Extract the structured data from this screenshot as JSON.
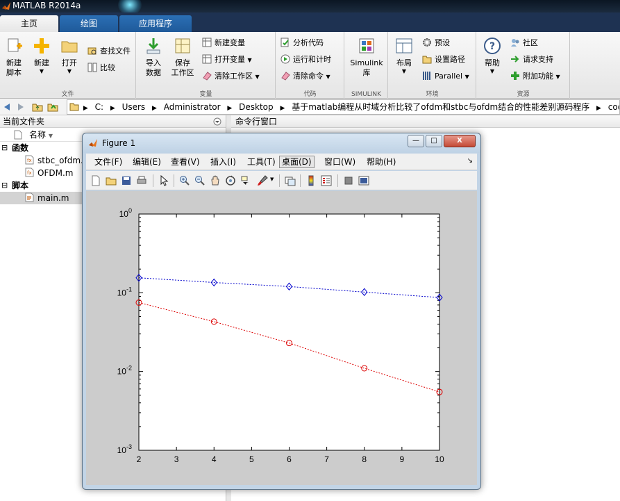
{
  "app": {
    "title": "MATLAB R2014a"
  },
  "tabs": [
    {
      "label": "主页",
      "active": true
    },
    {
      "label": "绘图",
      "active": false
    },
    {
      "label": "应用程序",
      "active": false
    }
  ],
  "ribbon": {
    "file": {
      "group_label": "文件",
      "new_script": "新建\n脚本",
      "new": "新建",
      "open": "打开",
      "find_files": "查找文件",
      "compare": "比较"
    },
    "variable": {
      "group_label": "变量",
      "import_data": "导入\n数据",
      "save_workspace": "保存\n工作区",
      "new_variable": "新建变量",
      "open_variable": "打开变量",
      "clear_workspace": "清除工作区"
    },
    "code": {
      "group_label": "代码",
      "analyze_code": "分析代码",
      "run_and_time": "运行和计时",
      "clear_commands": "清除命令"
    },
    "simulink": {
      "group_label": "SIMULINK",
      "library": "Simulink\n库"
    },
    "environment": {
      "group_label": "环境",
      "layout": "布局",
      "preferences": "预设",
      "set_path": "设置路径",
      "parallel": "Parallel"
    },
    "resources": {
      "group_label": "资源",
      "help": "帮助",
      "community": "社区",
      "request_support": "请求支持",
      "addons": "附加功能"
    }
  },
  "address": {
    "crumbs": [
      "C:",
      "Users",
      "Administrator",
      "Desktop",
      "基于matlab编程从时域分析比较了ofdm和stbc与ofdm结合的性能差别源码程序",
      "code"
    ]
  },
  "current_folder": {
    "header": "当前文件夹",
    "column_name": "名称",
    "groups": [
      {
        "label": "函数",
        "files": [
          "stbc_ofdm.m",
          "OFDM.m"
        ]
      },
      {
        "label": "脚本",
        "files": [
          "main.m"
        ]
      }
    ],
    "selected_file": "main.m"
  },
  "command_window": {
    "header": "命令行窗口"
  },
  "figure": {
    "title": "Figure 1",
    "menu": [
      "文件(F)",
      "编辑(E)",
      "查看(V)",
      "插入(I)",
      "工具(T)",
      "桌面(D)",
      "窗口(W)",
      "帮助(H)"
    ],
    "pressed_menu": "桌面(D)",
    "window_buttons": {
      "minimize": "—",
      "maximize": "□",
      "close": "X"
    }
  },
  "chart_data": {
    "type": "line",
    "x": [
      2,
      4,
      6,
      8,
      10
    ],
    "xlim": [
      2,
      10
    ],
    "xticks": [
      2,
      3,
      4,
      5,
      6,
      7,
      8,
      9,
      10
    ],
    "ylim": [
      0.001,
      1
    ],
    "yscale": "log",
    "yticks": [
      0.001,
      0.01,
      0.1,
      1
    ],
    "ytick_labels": [
      {
        "base": "10",
        "exp": "-3"
      },
      {
        "base": "10",
        "exp": "-2"
      },
      {
        "base": "10",
        "exp": "-1"
      },
      {
        "base": "10",
        "exp": "0"
      }
    ],
    "grid": false,
    "series": [
      {
        "values": [
          0.155,
          0.135,
          0.12,
          0.102,
          0.087
        ],
        "color": "#0000cc",
        "marker": "diamond",
        "linestyle": "dotted"
      },
      {
        "values": [
          0.075,
          0.043,
          0.023,
          0.011,
          0.0055
        ],
        "color": "#dd0000",
        "marker": "circle",
        "linestyle": "dotted"
      }
    ]
  }
}
